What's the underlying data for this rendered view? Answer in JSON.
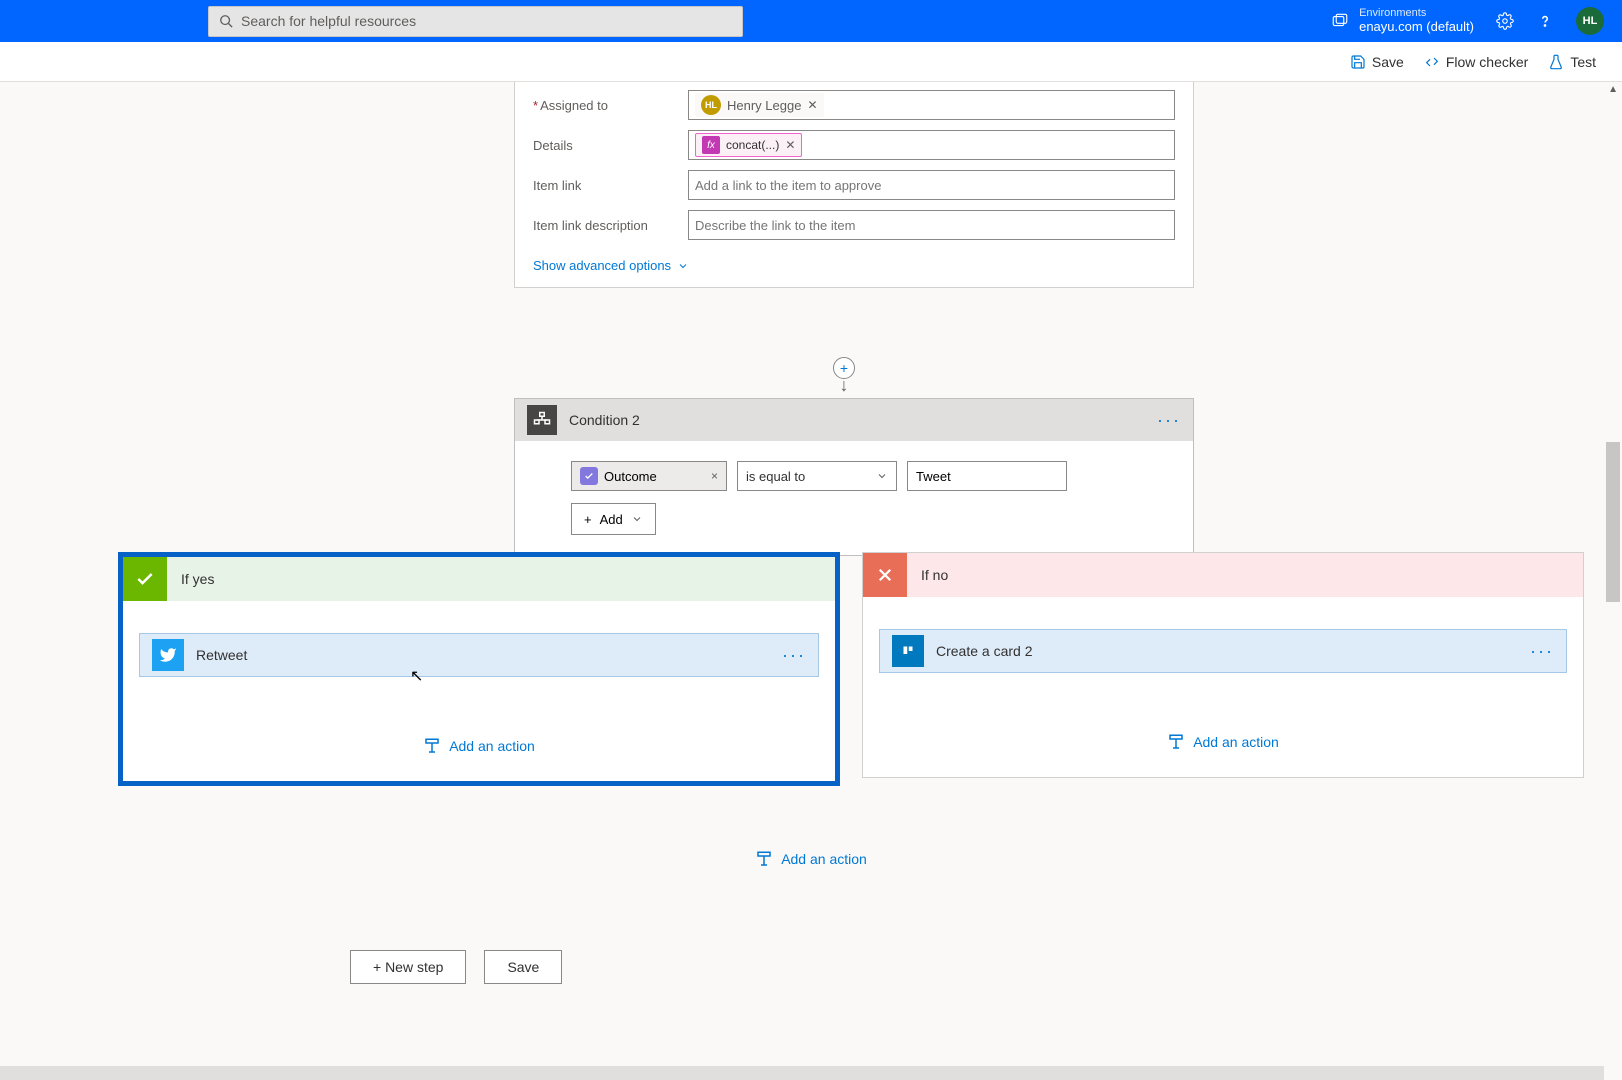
{
  "header": {
    "search_placeholder": "Search for helpful resources",
    "env_label": "Environments",
    "env_value": "enayu.com (default)",
    "avatar_initials": "HL"
  },
  "toolbar": {
    "save": "Save",
    "flow_checker": "Flow checker",
    "test": "Test"
  },
  "approval": {
    "fields": {
      "assigned_to": {
        "label": "Assigned to",
        "required": true,
        "person_initials": "HL",
        "person_name": "Henry Legge"
      },
      "details": {
        "label": "Details",
        "token": "concat(...)"
      },
      "item_link": {
        "label": "Item link",
        "placeholder": "Add a link to the item to approve"
      },
      "item_link_desc": {
        "label": "Item link description",
        "placeholder": "Describe the link to the item"
      }
    },
    "advanced_link": "Show advanced options"
  },
  "condition": {
    "title": "Condition 2",
    "left_token": "Outcome",
    "operator": "is equal to",
    "value": "Tweet",
    "add_label": "Add"
  },
  "branches": {
    "yes": {
      "title": "If yes",
      "action_title": "Retweet",
      "add_action": "Add an action"
    },
    "no": {
      "title": "If no",
      "action_title": "Create a card 2",
      "add_action": "Add an action"
    }
  },
  "outer_add_action": "Add an action",
  "bottom": {
    "new_step": "+ New step",
    "save": "Save"
  }
}
